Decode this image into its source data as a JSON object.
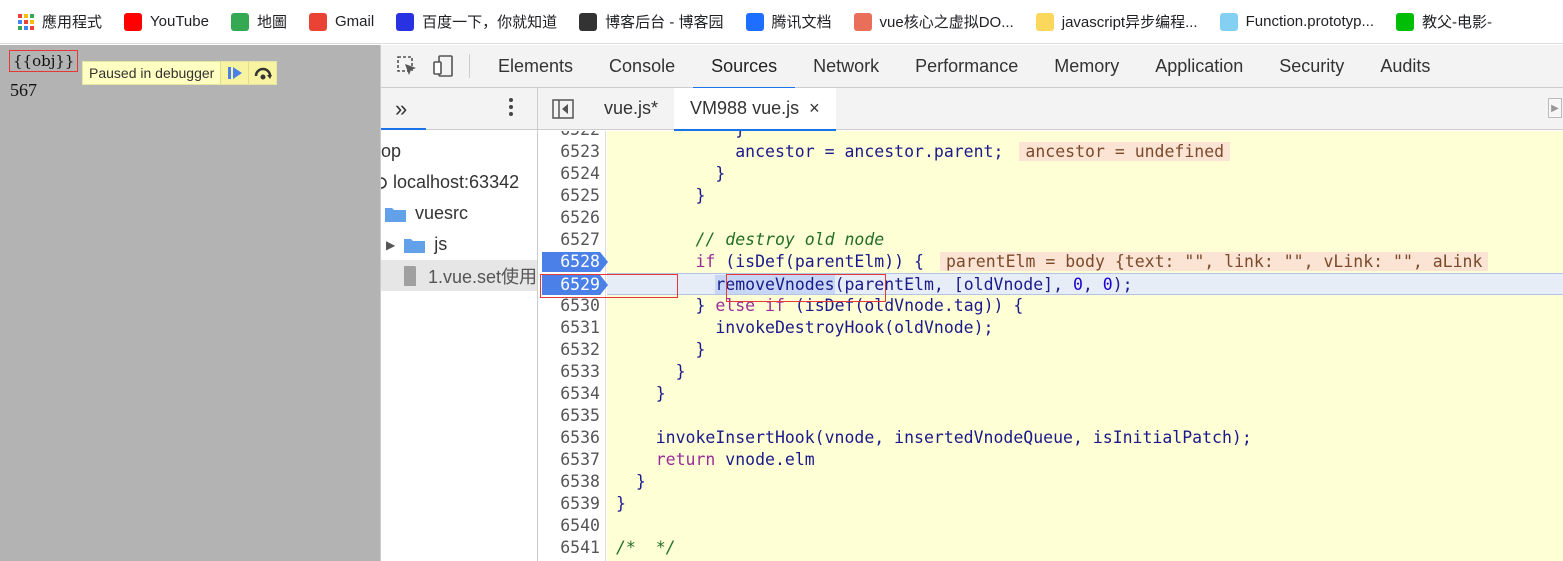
{
  "bookmarks": [
    {
      "label": "應用程式",
      "icon": "apps-grid-icon",
      "color": "#ea4335"
    },
    {
      "label": "YouTube",
      "icon": "youtube-icon",
      "color": "#ff0000"
    },
    {
      "label": "地圖",
      "icon": "maps-icon",
      "color": "#34a853"
    },
    {
      "label": "Gmail",
      "icon": "gmail-icon",
      "color": "#ea4335"
    },
    {
      "label": "百度一下，你就知道",
      "icon": "baidu-icon",
      "color": "#2932e1"
    },
    {
      "label": "博客后台 - 博客园",
      "icon": "cnblogs-icon",
      "color": "#333333"
    },
    {
      "label": "腾讯文档",
      "icon": "tencent-docs-icon",
      "color": "#1e6fff"
    },
    {
      "label": "vue核心之虚拟DO...",
      "icon": "jianshu-icon",
      "color": "#ea6f5a"
    },
    {
      "label": "javascript异步编程...",
      "icon": "folder-doc-icon",
      "color": "#fbd75b"
    },
    {
      "label": "Function.prototyp...",
      "icon": "mdn-icon",
      "color": "#83d0f2"
    },
    {
      "label": "教父-电影-",
      "icon": "iqiyi-icon",
      "color": "#00be06"
    }
  ],
  "page": {
    "template_text": "{{obj}}",
    "value_text": "567",
    "paused_label": "Paused in debugger"
  },
  "devtools": {
    "tabs": [
      "Elements",
      "Console",
      "Sources",
      "Network",
      "Performance",
      "Memory",
      "Application",
      "Security",
      "Audits"
    ],
    "active_tab": "Sources",
    "navigator": {
      "rows": [
        "op",
        "localhost:63342",
        "vuesrc",
        "js",
        "1.vue.set使用"
      ]
    },
    "editor_tabs": [
      {
        "label": "vue.js*"
      },
      {
        "label": "VM988 vue.js",
        "close": "×"
      }
    ]
  },
  "code": {
    "lines": [
      {
        "n": "6522",
        "text": "            }"
      },
      {
        "n": "6523",
        "text": "            ancestor = ancestor.parent;",
        "inline": "ancestor = undefined"
      },
      {
        "n": "6524",
        "text": "          }"
      },
      {
        "n": "6525",
        "text": "        }"
      },
      {
        "n": "6526",
        "text": ""
      },
      {
        "n": "6527",
        "text": "        // destroy old node"
      },
      {
        "n": "6528",
        "text": "        if (isDef(parentElm)) {",
        "inline": "parentElm = body {text: \"\", link: \"\", vLink: \"\", aLink"
      },
      {
        "n": "6529",
        "text": "          removeVnodes(parentElm, [oldVnode], 0, 0);"
      },
      {
        "n": "6530",
        "text": "        } else if (isDef(oldVnode.tag)) {"
      },
      {
        "n": "6531",
        "text": "          invokeDestroyHook(oldVnode);"
      },
      {
        "n": "6532",
        "text": "        }"
      },
      {
        "n": "6533",
        "text": "      }"
      },
      {
        "n": "6534",
        "text": "    }"
      },
      {
        "n": "6535",
        "text": ""
      },
      {
        "n": "6536",
        "text": "    invokeInsertHook(vnode, insertedVnodeQueue, isInitialPatch);"
      },
      {
        "n": "6537",
        "text": "    return vnode.elm"
      },
      {
        "n": "6538",
        "text": "  }"
      },
      {
        "n": "6539",
        "text": "}"
      },
      {
        "n": "6540",
        "text": ""
      },
      {
        "n": "6541",
        "text": "/*  */"
      }
    ]
  },
  "colors": {
    "accent": "#1a73e8",
    "breakpoint": "#4a80e8",
    "highlight_box": "#e53935",
    "code_bg": "#ffffd6"
  }
}
